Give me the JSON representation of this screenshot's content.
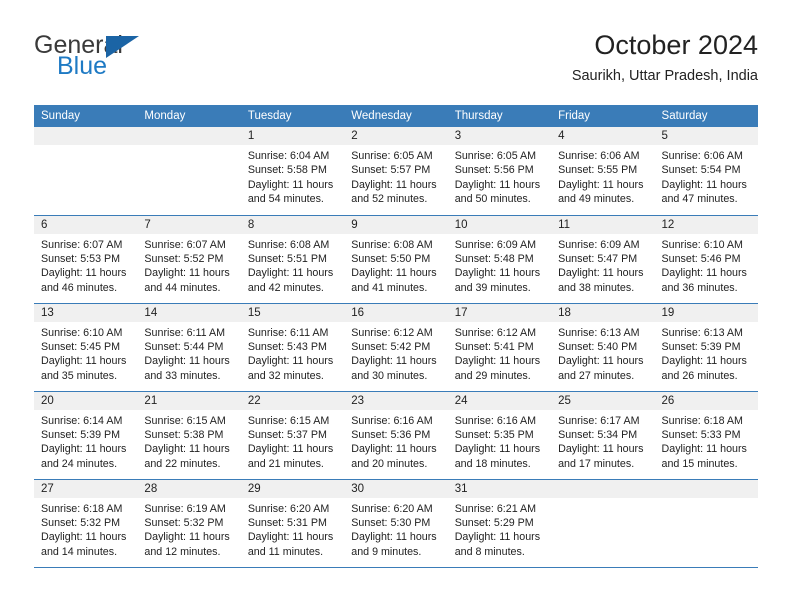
{
  "brand": {
    "name_top": "General",
    "name_bottom": "Blue",
    "triangle_icon": "triangle-logo-icon",
    "color_top": "#3a3a3a",
    "color_bottom": "#1e7ac4",
    "triangle_color": "#1b64a5"
  },
  "header": {
    "title": "October 2024",
    "subtitle": "Saurikh, Uttar Pradesh, India"
  },
  "colors": {
    "header_blue": "#3a7cb8",
    "daynum_band": "#f0f0f0",
    "text": "#222222"
  },
  "weekdays": [
    "Sunday",
    "Monday",
    "Tuesday",
    "Wednesday",
    "Thursday",
    "Friday",
    "Saturday"
  ],
  "weeks": [
    [
      {
        "day": "",
        "empty": true,
        "sunrise": "",
        "sunset": "",
        "daylight_line1": "",
        "daylight_line2": ""
      },
      {
        "day": "",
        "empty": true,
        "sunrise": "",
        "sunset": "",
        "daylight_line1": "",
        "daylight_line2": ""
      },
      {
        "day": "1",
        "sunrise": "Sunrise: 6:04 AM",
        "sunset": "Sunset: 5:58 PM",
        "daylight_line1": "Daylight: 11 hours",
        "daylight_line2": "and 54 minutes."
      },
      {
        "day": "2",
        "sunrise": "Sunrise: 6:05 AM",
        "sunset": "Sunset: 5:57 PM",
        "daylight_line1": "Daylight: 11 hours",
        "daylight_line2": "and 52 minutes."
      },
      {
        "day": "3",
        "sunrise": "Sunrise: 6:05 AM",
        "sunset": "Sunset: 5:56 PM",
        "daylight_line1": "Daylight: 11 hours",
        "daylight_line2": "and 50 minutes."
      },
      {
        "day": "4",
        "sunrise": "Sunrise: 6:06 AM",
        "sunset": "Sunset: 5:55 PM",
        "daylight_line1": "Daylight: 11 hours",
        "daylight_line2": "and 49 minutes."
      },
      {
        "day": "5",
        "sunrise": "Sunrise: 6:06 AM",
        "sunset": "Sunset: 5:54 PM",
        "daylight_line1": "Daylight: 11 hours",
        "daylight_line2": "and 47 minutes."
      }
    ],
    [
      {
        "day": "6",
        "sunrise": "Sunrise: 6:07 AM",
        "sunset": "Sunset: 5:53 PM",
        "daylight_line1": "Daylight: 11 hours",
        "daylight_line2": "and 46 minutes."
      },
      {
        "day": "7",
        "sunrise": "Sunrise: 6:07 AM",
        "sunset": "Sunset: 5:52 PM",
        "daylight_line1": "Daylight: 11 hours",
        "daylight_line2": "and 44 minutes."
      },
      {
        "day": "8",
        "sunrise": "Sunrise: 6:08 AM",
        "sunset": "Sunset: 5:51 PM",
        "daylight_line1": "Daylight: 11 hours",
        "daylight_line2": "and 42 minutes."
      },
      {
        "day": "9",
        "sunrise": "Sunrise: 6:08 AM",
        "sunset": "Sunset: 5:50 PM",
        "daylight_line1": "Daylight: 11 hours",
        "daylight_line2": "and 41 minutes."
      },
      {
        "day": "10",
        "sunrise": "Sunrise: 6:09 AM",
        "sunset": "Sunset: 5:48 PM",
        "daylight_line1": "Daylight: 11 hours",
        "daylight_line2": "and 39 minutes."
      },
      {
        "day": "11",
        "sunrise": "Sunrise: 6:09 AM",
        "sunset": "Sunset: 5:47 PM",
        "daylight_line1": "Daylight: 11 hours",
        "daylight_line2": "and 38 minutes."
      },
      {
        "day": "12",
        "sunrise": "Sunrise: 6:10 AM",
        "sunset": "Sunset: 5:46 PM",
        "daylight_line1": "Daylight: 11 hours",
        "daylight_line2": "and 36 minutes."
      }
    ],
    [
      {
        "day": "13",
        "sunrise": "Sunrise: 6:10 AM",
        "sunset": "Sunset: 5:45 PM",
        "daylight_line1": "Daylight: 11 hours",
        "daylight_line2": "and 35 minutes."
      },
      {
        "day": "14",
        "sunrise": "Sunrise: 6:11 AM",
        "sunset": "Sunset: 5:44 PM",
        "daylight_line1": "Daylight: 11 hours",
        "daylight_line2": "and 33 minutes."
      },
      {
        "day": "15",
        "sunrise": "Sunrise: 6:11 AM",
        "sunset": "Sunset: 5:43 PM",
        "daylight_line1": "Daylight: 11 hours",
        "daylight_line2": "and 32 minutes."
      },
      {
        "day": "16",
        "sunrise": "Sunrise: 6:12 AM",
        "sunset": "Sunset: 5:42 PM",
        "daylight_line1": "Daylight: 11 hours",
        "daylight_line2": "and 30 minutes."
      },
      {
        "day": "17",
        "sunrise": "Sunrise: 6:12 AM",
        "sunset": "Sunset: 5:41 PM",
        "daylight_line1": "Daylight: 11 hours",
        "daylight_line2": "and 29 minutes."
      },
      {
        "day": "18",
        "sunrise": "Sunrise: 6:13 AM",
        "sunset": "Sunset: 5:40 PM",
        "daylight_line1": "Daylight: 11 hours",
        "daylight_line2": "and 27 minutes."
      },
      {
        "day": "19",
        "sunrise": "Sunrise: 6:13 AM",
        "sunset": "Sunset: 5:39 PM",
        "daylight_line1": "Daylight: 11 hours",
        "daylight_line2": "and 26 minutes."
      }
    ],
    [
      {
        "day": "20",
        "sunrise": "Sunrise: 6:14 AM",
        "sunset": "Sunset: 5:39 PM",
        "daylight_line1": "Daylight: 11 hours",
        "daylight_line2": "and 24 minutes."
      },
      {
        "day": "21",
        "sunrise": "Sunrise: 6:15 AM",
        "sunset": "Sunset: 5:38 PM",
        "daylight_line1": "Daylight: 11 hours",
        "daylight_line2": "and 22 minutes."
      },
      {
        "day": "22",
        "sunrise": "Sunrise: 6:15 AM",
        "sunset": "Sunset: 5:37 PM",
        "daylight_line1": "Daylight: 11 hours",
        "daylight_line2": "and 21 minutes."
      },
      {
        "day": "23",
        "sunrise": "Sunrise: 6:16 AM",
        "sunset": "Sunset: 5:36 PM",
        "daylight_line1": "Daylight: 11 hours",
        "daylight_line2": "and 20 minutes."
      },
      {
        "day": "24",
        "sunrise": "Sunrise: 6:16 AM",
        "sunset": "Sunset: 5:35 PM",
        "daylight_line1": "Daylight: 11 hours",
        "daylight_line2": "and 18 minutes."
      },
      {
        "day": "25",
        "sunrise": "Sunrise: 6:17 AM",
        "sunset": "Sunset: 5:34 PM",
        "daylight_line1": "Daylight: 11 hours",
        "daylight_line2": "and 17 minutes."
      },
      {
        "day": "26",
        "sunrise": "Sunrise: 6:18 AM",
        "sunset": "Sunset: 5:33 PM",
        "daylight_line1": "Daylight: 11 hours",
        "daylight_line2": "and 15 minutes."
      }
    ],
    [
      {
        "day": "27",
        "sunrise": "Sunrise: 6:18 AM",
        "sunset": "Sunset: 5:32 PM",
        "daylight_line1": "Daylight: 11 hours",
        "daylight_line2": "and 14 minutes."
      },
      {
        "day": "28",
        "sunrise": "Sunrise: 6:19 AM",
        "sunset": "Sunset: 5:32 PM",
        "daylight_line1": "Daylight: 11 hours",
        "daylight_line2": "and 12 minutes."
      },
      {
        "day": "29",
        "sunrise": "Sunrise: 6:20 AM",
        "sunset": "Sunset: 5:31 PM",
        "daylight_line1": "Daylight: 11 hours",
        "daylight_line2": "and 11 minutes."
      },
      {
        "day": "30",
        "sunrise": "Sunrise: 6:20 AM",
        "sunset": "Sunset: 5:30 PM",
        "daylight_line1": "Daylight: 11 hours",
        "daylight_line2": "and 9 minutes."
      },
      {
        "day": "31",
        "sunrise": "Sunrise: 6:21 AM",
        "sunset": "Sunset: 5:29 PM",
        "daylight_line1": "Daylight: 11 hours",
        "daylight_line2": "and 8 minutes."
      },
      {
        "day": "",
        "empty": true,
        "sunrise": "",
        "sunset": "",
        "daylight_line1": "",
        "daylight_line2": ""
      },
      {
        "day": "",
        "empty": true,
        "sunrise": "",
        "sunset": "",
        "daylight_line1": "",
        "daylight_line2": ""
      }
    ]
  ]
}
